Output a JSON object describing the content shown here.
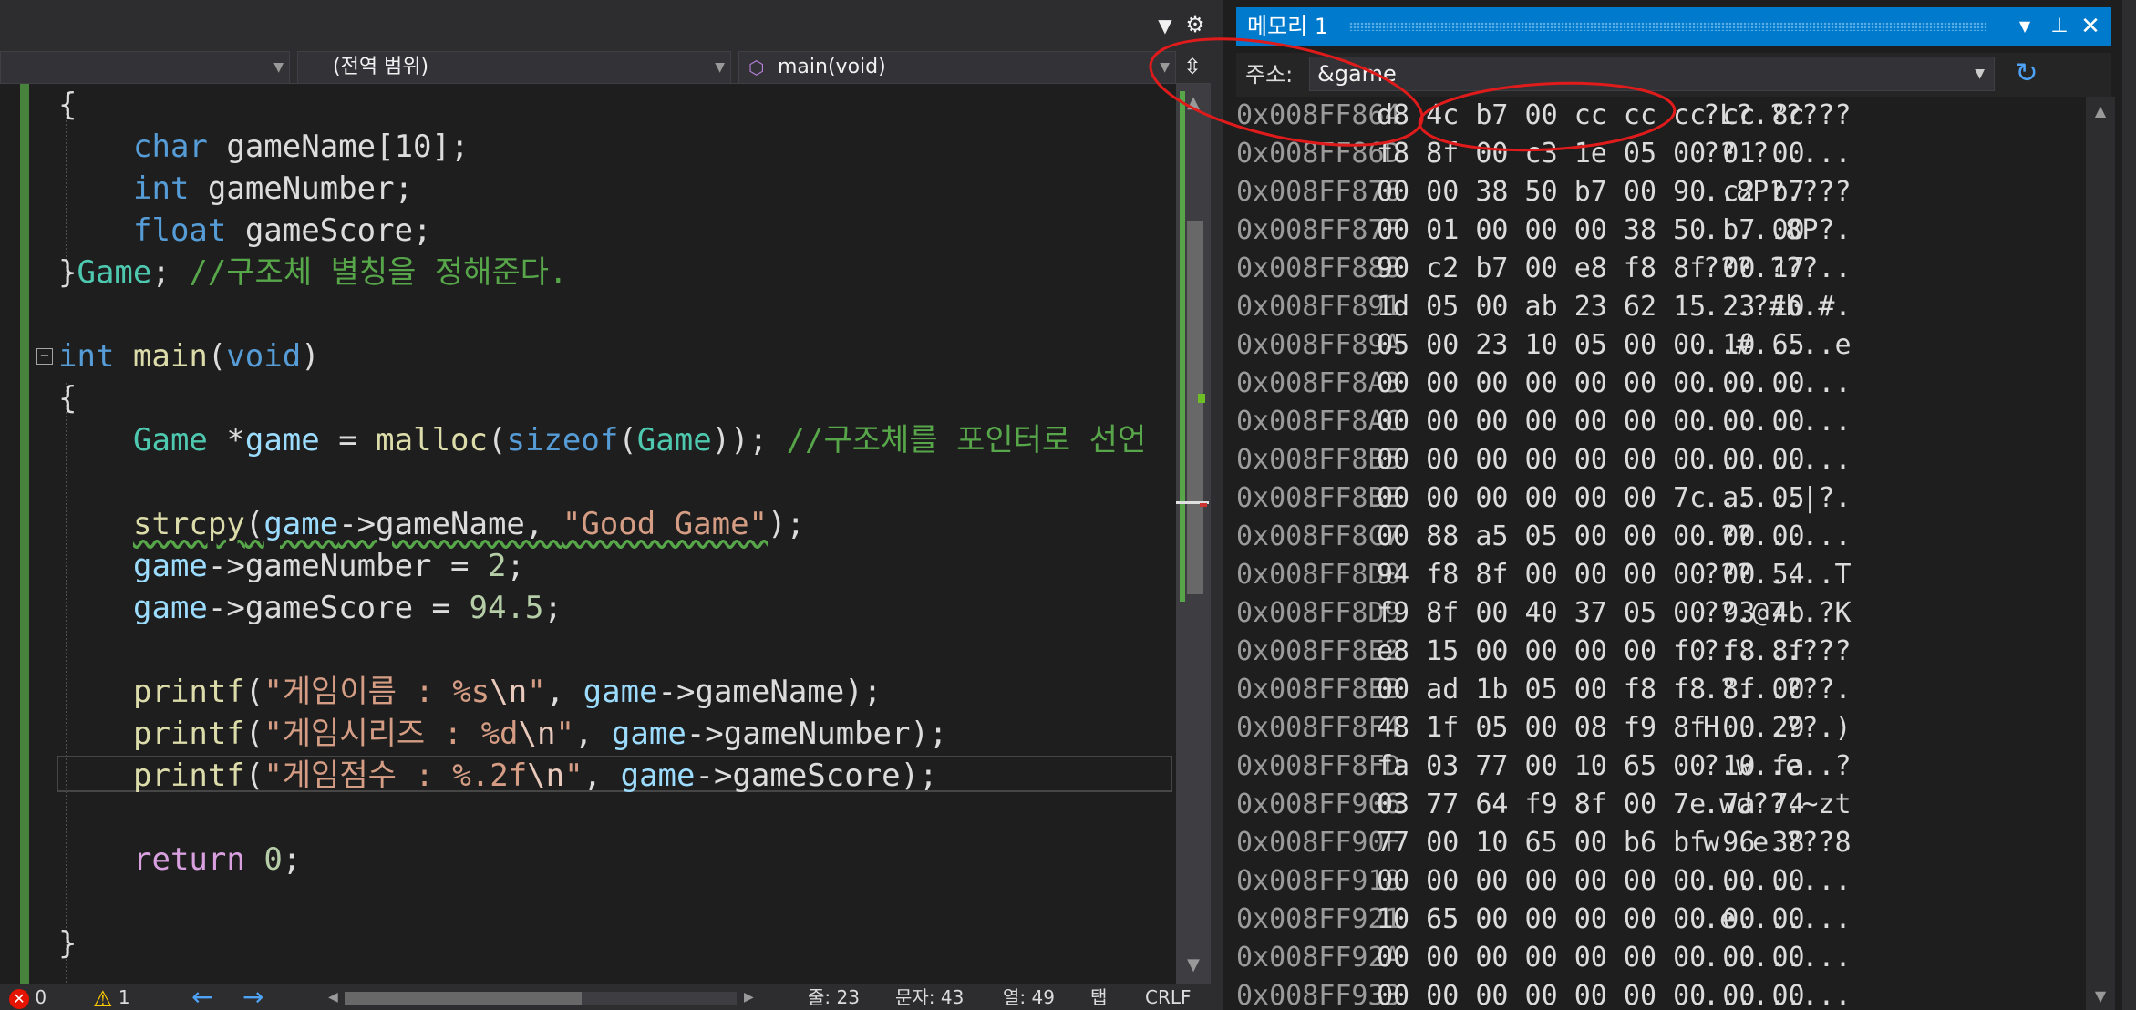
{
  "toolbar": {
    "dropdown_icon": "▼",
    "settings_icon": "⚙"
  },
  "navigation": {
    "project_combo": "",
    "scope_combo": "(전역 범위)",
    "member_combo": "main(void)",
    "member_icon": "cube-icon",
    "split_icon": "⇳"
  },
  "code": {
    "line1": "{",
    "line2_type": "char",
    "line2_rest": " gameName[10];",
    "line3_type": "int",
    "line3_rest": " gameNumber;",
    "line4_type": "float",
    "line4_rest": " gameScore;",
    "line5_brace": "}",
    "line5_name": "Game",
    "line5_semi": "; ",
    "line5_comment": "//구조체 별칭을 정해준다.",
    "line7_kw": "int",
    "line7_fn": "main",
    "line7_open": "(",
    "line7_void": "void",
    "line7_close": ")",
    "line8": "{",
    "line9_type": "Game",
    "line9_star": " *",
    "line9_var": "game",
    "line9_eq": " = ",
    "line9_fn": "malloc",
    "line9_p1": "(",
    "line9_sizeof": "sizeof",
    "line9_p2": "(",
    "line9_type2": "Game",
    "line9_end": ")); ",
    "line9_comment": "//구조체를 포인터로 선언",
    "line11_fn": "strcpy",
    "line11_p": "(",
    "line11_var": "game",
    "line11_arrow": "->gameName, ",
    "line11_str": "\"Good Game\"",
    "line11_end": ");",
    "line12_var": "game",
    "line12_rest": "->gameNumber = ",
    "line12_num": "2",
    "line12_end": ";",
    "line13_var": "game",
    "line13_rest": "->gameScore = ",
    "line13_num": "94.5",
    "line13_end": ";",
    "line15_fn": "printf",
    "line15_p": "(",
    "line15_str": "\"게임이름 : %s",
    "line15_esc": "\\n",
    "line15_q": "\"",
    "line15_comma": ", ",
    "line15_var": "game",
    "line15_end": "->gameName);",
    "line16_fn": "printf",
    "line16_p": "(",
    "line16_str": "\"게임시리즈 : %d",
    "line16_esc": "\\n",
    "line16_q": "\"",
    "line16_comma": ", ",
    "line16_var": "game",
    "line16_end": "->gameNumber);",
    "line17_fn": "printf",
    "line17_p": "(",
    "line17_str": "\"게임점수 : %.2f",
    "line17_esc": "\\n",
    "line17_q": "\"",
    "line17_comma": ", ",
    "line17_var": "game",
    "line17_end": "->gameScore);",
    "line19_kw": "return",
    "line19_sp": " ",
    "line19_num": "0",
    "line19_end": ";",
    "line21": "}"
  },
  "status_bar": {
    "errors": "0",
    "warnings": "1",
    "back_icon": "←",
    "forward_icon": "→",
    "line": "줄: 23",
    "char": "문자: 43",
    "col": "열: 49",
    "tab": "탭",
    "eol": "CRLF"
  },
  "memory_window": {
    "title": "메모리 1",
    "pin_icon": "📌",
    "close_icon": "✕",
    "address_label": "주소:",
    "address_value": "&game",
    "refresh_icon": "↻",
    "rows": [
      {
        "addr": "0x008FF864",
        "bytes": "d8 4c b7 00 cc cc cc cc 8c",
        "ascii": "?L?.?????"
      },
      {
        "addr": "0x008FF86D",
        "bytes": "f8 8f 00 c3 1e 05 00 01 00",
        "ascii": "??.?....."
      },
      {
        "addr": "0x008FF876",
        "bytes": "00 00 38 50 b7 00 90 c2 b7",
        "ascii": "..8P?.???"
      },
      {
        "addr": "0x008FF87F",
        "bytes": "00 01 00 00 00 38 50 b7 00",
        "ascii": ".....8P?."
      },
      {
        "addr": "0x008FF888",
        "bytes": "90 c2 b7 00 e8 f8 8f 00 17",
        "ascii": "???.???.."
      },
      {
        "addr": "0x008FF891",
        "bytes": "1d 05 00 ab 23 62 15 23 10",
        "ascii": "...?#b.#."
      },
      {
        "addr": "0x008FF89A",
        "bytes": "05 00 23 10 05 00 00 10 65",
        "ascii": "..#.....e"
      },
      {
        "addr": "0x008FF8A3",
        "bytes": "00 00 00 00 00 00 00 00 00",
        "ascii": "........."
      },
      {
        "addr": "0x008FF8AC",
        "bytes": "00 00 00 00 00 00 00 00 00",
        "ascii": "........."
      },
      {
        "addr": "0x008FF8B5",
        "bytes": "00 00 00 00 00 00 00 00 00",
        "ascii": "........."
      },
      {
        "addr": "0x008FF8BE",
        "bytes": "00 00 00 00 00 00 7c a5 05",
        "ascii": "......|?."
      },
      {
        "addr": "0x008FF8C7",
        "bytes": "00 88 a5 05 00 00 00 00 00",
        "ascii": ".??......"
      },
      {
        "addr": "0x008FF8D0",
        "bytes": "94 f8 8f 00 00 00 00 00 54",
        "ascii": "???.....T"
      },
      {
        "addr": "0x008FF8D9",
        "bytes": "f9 8f 00 40 37 05 00 93 4b",
        "ascii": "??.@7..?K"
      },
      {
        "addr": "0x008FF8E2",
        "bytes": "e8 15 00 00 00 00 f0 f8 8f",
        "ascii": "?.....???"
      },
      {
        "addr": "0x008FF8EB",
        "bytes": "00 ad 1b 05 00 f8 f8 8f 00",
        "ascii": ".?...???."
      },
      {
        "addr": "0x008FF8F4",
        "bytes": "48 1f 05 00 08 f9 8f 00 29",
        "ascii": "H....??.)"
      },
      {
        "addr": "0x008FF8FD",
        "bytes": "fa 03 77 00 10 65 00 10 fa",
        "ascii": "?.w..e..?"
      },
      {
        "addr": "0x008FF906",
        "bytes": "03 77 64 f9 8f 00 7e 7a 74",
        "ascii": ".wd??.~zt"
      },
      {
        "addr": "0x008FF90F",
        "bytes": "77 00 10 65 00 b6 bf 96 38",
        "ascii": "w..e.???8"
      },
      {
        "addr": "0x008FF918",
        "bytes": "00 00 00 00 00 00 00 00 00",
        "ascii": "........."
      },
      {
        "addr": "0x008FF921",
        "bytes": "10 65 00 00 00 00 00 00 00",
        "ascii": ".e......."
      },
      {
        "addr": "0x008FF92A",
        "bytes": "00 00 00 00 00 00 00 00 00",
        "ascii": "........."
      },
      {
        "addr": "0x008FF933",
        "bytes": "00 00 00 00 00 00 00 00 00",
        "ascii": "........."
      }
    ]
  },
  "colors": {
    "keyword": "#569cd6",
    "type": "#4ec9b0",
    "function": "#dcdcaa",
    "variable": "#9cdcfe",
    "string": "#d69d85",
    "number": "#b5cea8",
    "comment": "#57a64a",
    "control": "#d8a0df",
    "title_bar": "#007acc",
    "annotation": "#e01b1b"
  }
}
